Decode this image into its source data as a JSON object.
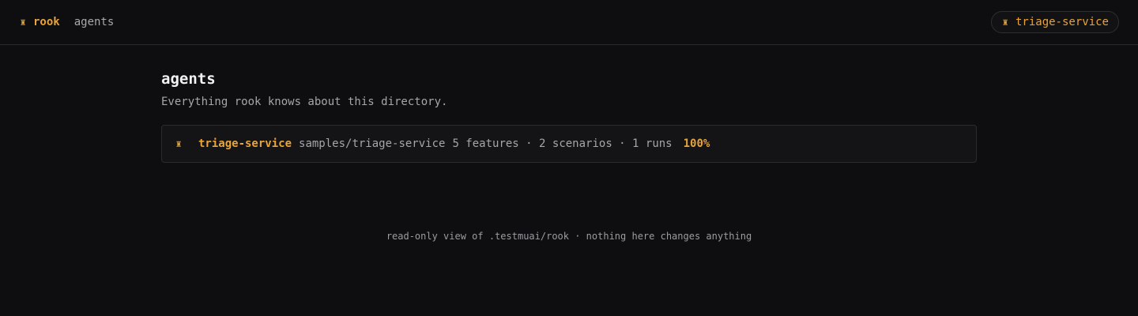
{
  "header": {
    "brand": "rook",
    "nav_label": "agents",
    "project_label": "triage-service",
    "icon": "rook-chess-icon"
  },
  "main": {
    "title": "agents",
    "subtitle": "Everything rook knows about this directory.",
    "agents": [
      {
        "name": "triage-service",
        "path": "samples/triage-service",
        "stats": "5 features · 2 scenarios · 1 runs",
        "score": "100%"
      }
    ]
  },
  "footer": {
    "note": "read-only view of .testmuai/rook · nothing here changes anything"
  },
  "colors": {
    "background": "#0e0e10",
    "accent": "#e8a33a",
    "muted_text": "#a6a6aa",
    "border": "#2a2a2f"
  }
}
